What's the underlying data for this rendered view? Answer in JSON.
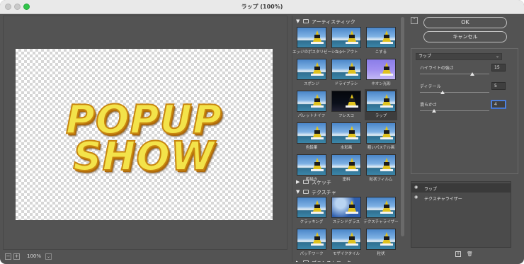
{
  "window": {
    "title": "ラップ (100%)"
  },
  "zoom": {
    "value": "100%"
  },
  "artwork": {
    "line1": "POPUP",
    "line2": "SHOW"
  },
  "gallery": {
    "categories": [
      {
        "label": "アーティスティック",
        "expanded": true
      },
      {
        "label": "スケッチ",
        "expanded": false
      },
      {
        "label": "テクスチャ",
        "expanded": true
      },
      {
        "label": "ブラシストローク",
        "expanded": false
      }
    ],
    "artistic": [
      "エッジのポスタリゼーション",
      "カットアウト",
      "こする",
      "スポンジ",
      "ドライブラシ",
      "ネオン光彩",
      "パレットナイフ",
      "フレスコ",
      "ラップ",
      "色鉛筆",
      "水彩画",
      "粗いパステル画",
      "粗描き",
      "塗料",
      "粒状フィルム"
    ],
    "texture": [
      "クラッキング",
      "ステンドグラス",
      "テクスチャライザー",
      "パッチワーク",
      "モザイクタイル",
      "粒状"
    ],
    "selected": "ラップ"
  },
  "buttons": {
    "collapse": "⌃",
    "ok": "OK",
    "cancel": "キャンセル"
  },
  "settings": {
    "filter": "ラップ",
    "params": [
      {
        "label": "ハイライトの強さ",
        "value": "15",
        "fraction": 0.75
      },
      {
        "label": "ディテール",
        "value": "5",
        "fraction": 0.33
      },
      {
        "label": "滑らかさ",
        "value": "4",
        "fraction": 0.2
      }
    ]
  },
  "effects": {
    "layers": [
      "ラップ",
      "テクスチャライザー"
    ]
  }
}
